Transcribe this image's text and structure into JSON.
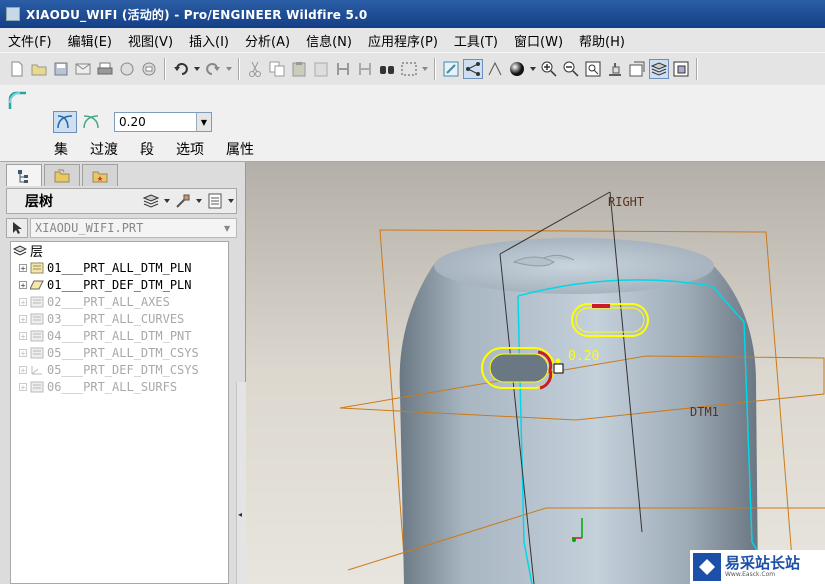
{
  "window": {
    "title": "XIAODU_WIFI (活动的) - Pro/ENGINEER Wildfire 5.0"
  },
  "menu": [
    {
      "label": "文件(F)"
    },
    {
      "label": "编辑(E)"
    },
    {
      "label": "视图(V)"
    },
    {
      "label": "插入(I)"
    },
    {
      "label": "分析(A)"
    },
    {
      "label": "信息(N)"
    },
    {
      "label": "应用程序(P)"
    },
    {
      "label": "工具(T)"
    },
    {
      "label": "窗口(W)"
    },
    {
      "label": "帮助(H)"
    }
  ],
  "dashboard": {
    "radius_value": "0.20",
    "tabs": [
      {
        "label": "集"
      },
      {
        "label": "过渡"
      },
      {
        "label": "段"
      },
      {
        "label": "选项"
      },
      {
        "label": "属性"
      }
    ]
  },
  "model_tree": {
    "title": "层树",
    "model_name": "XIAODU_WIFI.PRT",
    "root_label": "层",
    "layers": [
      {
        "name": "01___PRT_ALL_DTM_PLN",
        "state": "visible"
      },
      {
        "name": "01___PRT_DEF_DTM_PLN",
        "state": "visible"
      },
      {
        "name": "02___PRT_ALL_AXES",
        "state": "hidden"
      },
      {
        "name": "03___PRT_ALL_CURVES",
        "state": "hidden"
      },
      {
        "name": "04___PRT_ALL_DTM_PNT",
        "state": "hidden"
      },
      {
        "name": "05___PRT_ALL_DTM_CSYS",
        "state": "hidden"
      },
      {
        "name": "05___PRT_DEF_DTM_CSYS",
        "state": "hidden"
      },
      {
        "name": "06___PRT_ALL_SURFS",
        "state": "hidden"
      }
    ]
  },
  "viewport": {
    "labels": {
      "datum_right": "RIGHT",
      "datum_dtm1": "DTM1",
      "radius_tag": "0.20"
    }
  },
  "watermark": {
    "text": "易采站长站",
    "sub": "Www.Easck.Com"
  },
  "colors": {
    "title_bar": "#1f4f96",
    "selection": "#ffff00",
    "datum": "#cc7a1a",
    "accent_cyan": "#00d8e8",
    "flag_red": "#cc1a2a"
  }
}
